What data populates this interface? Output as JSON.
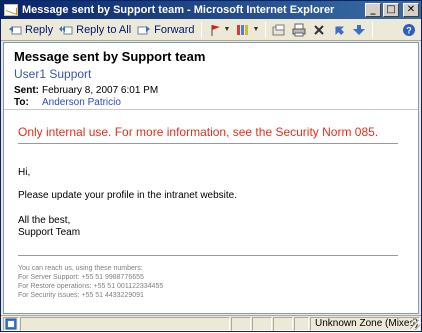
{
  "window": {
    "title": "Message sent by Support team - Microsoft Internet Explorer",
    "min_glyph": "_",
    "max_glyph": "□",
    "close_glyph": "✕"
  },
  "toolbar": {
    "reply_label": "Reply",
    "reply_all_label": "Reply to All",
    "forward_label": "Forward"
  },
  "message": {
    "subject": "Message sent by Support team",
    "sender": "User1 Support",
    "sent_label": "Sent:",
    "sent_value": "February 8, 2007 6:01 PM",
    "to_label": "To:",
    "to_value": "Anderson Patricio",
    "warning": "Only internal use. For more information, see the Security Norm 085.",
    "greeting": "Hi,",
    "body": "Please update your profile in the intranet website.",
    "closing": "All the best,",
    "signature": "Support Team",
    "footer": [
      "You can reach us, using these numbers:",
      "For Server Support: +55 51 9988776655",
      "For Restore operations: +55 51 001122334455",
      "For Security issues: +55 51 4433229091"
    ]
  },
  "statusbar": {
    "zone": "Unknown Zone (Mixed)"
  },
  "colors": {
    "warning": "#e0301e",
    "sender": "#3a55b4",
    "titlebar": "#0a246a"
  }
}
